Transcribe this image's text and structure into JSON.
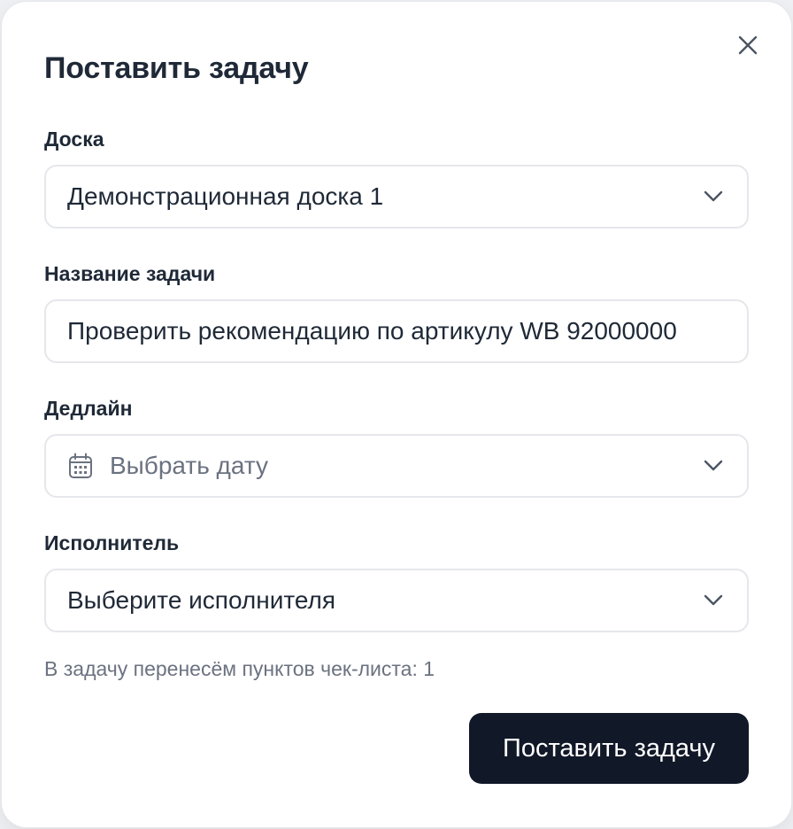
{
  "modal": {
    "title": "Поставить задачу",
    "close_icon": "close-icon"
  },
  "board": {
    "label": "Доска",
    "value": "Демонстрационная доска 1",
    "icon": "chevron-down-icon"
  },
  "task_name": {
    "label": "Название задачи",
    "value": "Проверить рекомендацию по артикулу WB 92000000"
  },
  "deadline": {
    "label": "Дедлайн",
    "placeholder": "Выбрать дату",
    "icon": "calendar-icon"
  },
  "assignee": {
    "label": "Исполнитель",
    "placeholder": "Выберите исполнителя"
  },
  "hint": "В задачу перенесём пунктов чек-листа: 1",
  "submit_label": "Поставить задачу",
  "colors": {
    "primary_button": "#111827",
    "border": "#e5e7eb",
    "text": "#1f2937",
    "muted": "#6b7280"
  }
}
